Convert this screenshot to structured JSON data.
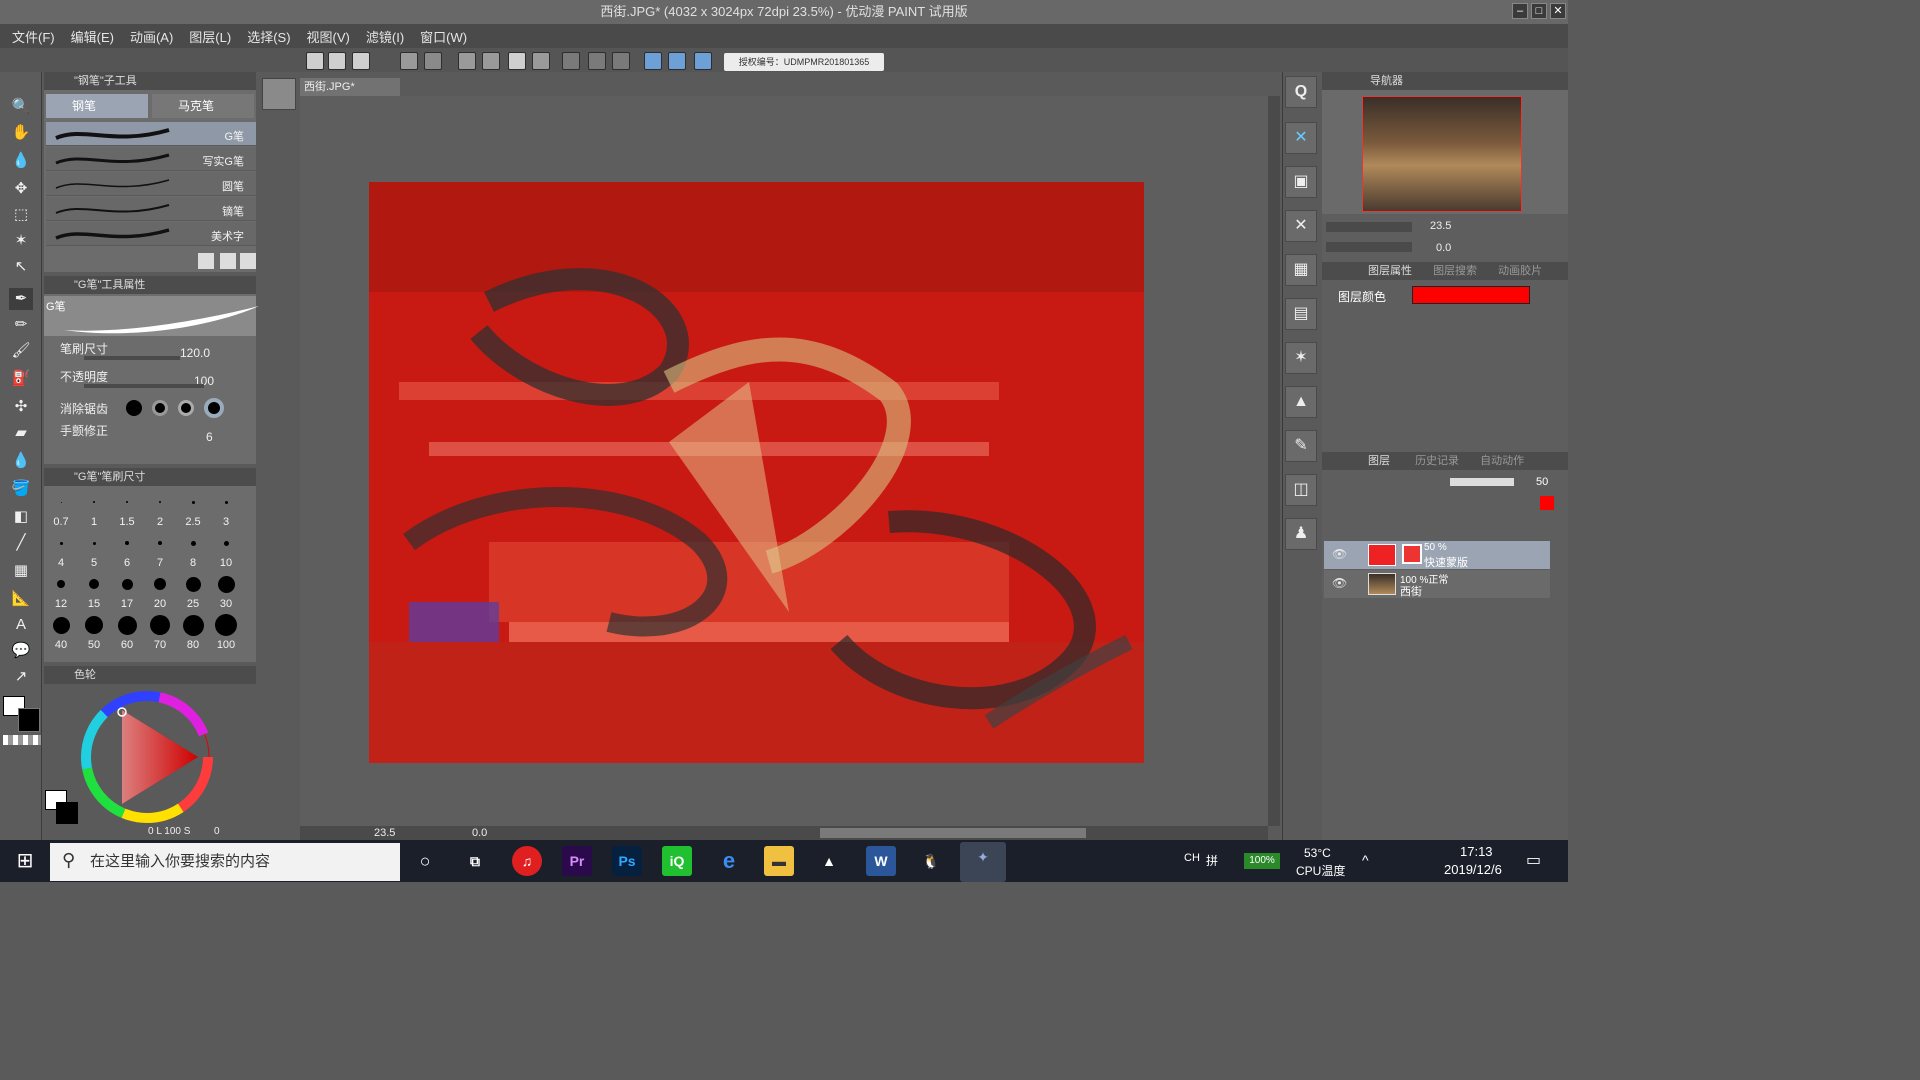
{
  "window": {
    "title": "西街.JPG* (4032 x 3024px 72dpi 23.5%) - 优动漫 PAINT 试用版"
  },
  "menu": [
    "文件(F)",
    "编辑(E)",
    "动画(A)",
    "图层(L)",
    "选择(S)",
    "视图(V)",
    "滤镜(I)",
    "窗口(W)"
  ],
  "license_badge": "授权编号：UDMPMR201801365",
  "subtool_panel": {
    "title": "\"钢笔\"子工具",
    "tabs": [
      "钢笔",
      "马克笔"
    ],
    "brushes": [
      "G笔",
      "写实G笔",
      "圆笔",
      "镝笔",
      "美术字"
    ]
  },
  "tool_property": {
    "title": "\"G笔\"工具属性",
    "brush_name": "G笔",
    "size_label": "笔刷尺寸",
    "size_value": "120.0",
    "opacity_label": "不透明度",
    "opacity_value": "100",
    "antialias_label": "消除锯齿",
    "stabilize_label": "手颤修正",
    "stabilize_value": "6"
  },
  "brush_size_panel": {
    "title": "\"G笔\"笔刷尺寸",
    "sizes": [
      "0.7",
      "1",
      "1.5",
      "2",
      "2.5",
      "3",
      "4",
      "5",
      "6",
      "7",
      "8",
      "10",
      "12",
      "15",
      "17",
      "20",
      "25",
      "30",
      "40",
      "50",
      "60",
      "70",
      "80",
      "100"
    ]
  },
  "color_panel": {
    "title": "色轮",
    "values": "0 L 100 S",
    "extra": "0"
  },
  "document_tab": "西街.JPG*",
  "status": {
    "zoom": "23.5",
    "rotation": "0.0"
  },
  "navigator": {
    "title": "导航器",
    "zoom": "23.5",
    "rotation": "0.0"
  },
  "layer_property": {
    "tab": "图层属性",
    "tab2": "图层搜索",
    "tab3": "动画胶片",
    "color_label": "图层颜色",
    "color": "#ff0000"
  },
  "layers_panel": {
    "tabs": [
      "图层",
      "历史记录",
      "自动动作"
    ],
    "opacity": "50",
    "layers": [
      {
        "percent": "50 %",
        "name": "快速蒙版"
      },
      {
        "percent": "100 %正常",
        "name": "西街"
      }
    ]
  },
  "taskbar": {
    "search_placeholder": "在这里输入你要搜索的内容",
    "lang": "CH",
    "ime": "拼",
    "battery": "100%",
    "temp": "53°C",
    "temp_label": "CPU温度",
    "time": "17:13",
    "date": "2019/12/6"
  },
  "colors": {
    "accent": "#ff0000",
    "mask_red": "#e0281c",
    "ui_bg": "#5a5a5a"
  }
}
